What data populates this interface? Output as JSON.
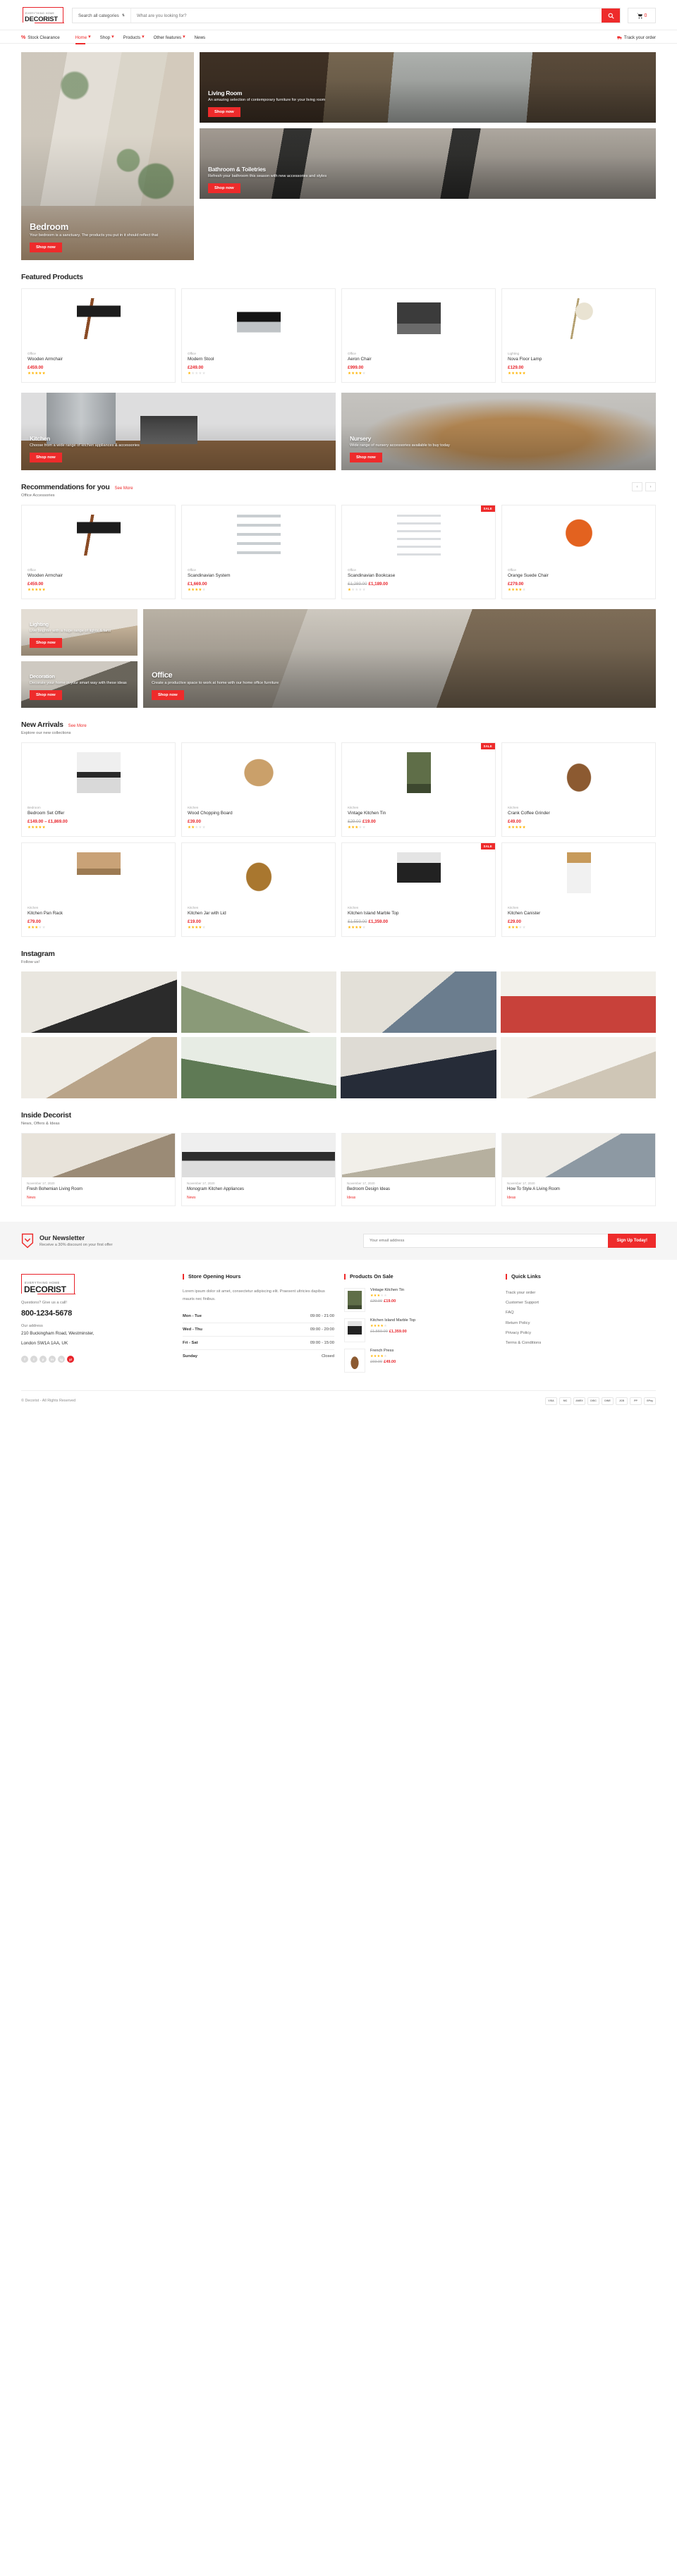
{
  "brand": {
    "tagline": "EVERYTHING HOME",
    "name": "DECORIST",
    "accent": "#ee2b2b"
  },
  "header": {
    "search_category": "Search all categories",
    "search_placeholder": "What are you looking for?",
    "search_value": "",
    "search_icon": "search-icon",
    "cart_icon": "cart-icon",
    "cart_count": "0"
  },
  "nav": {
    "stock_clearance": "Stock Clearance",
    "items": [
      {
        "label": "Home",
        "has_caret": true,
        "active": true
      },
      {
        "label": "Shop",
        "has_caret": true,
        "active": false
      },
      {
        "label": "Products",
        "has_caret": true,
        "active": false
      },
      {
        "label": "Other features",
        "has_caret": true,
        "active": false
      },
      {
        "label": "News",
        "has_caret": false,
        "active": false
      }
    ],
    "track_order": "Track your order"
  },
  "hero": {
    "bedroom": {
      "title": "Bedroom",
      "subtitle": "Your bedroom is a sanctuary. The products you put in it should reflect that",
      "cta": "Shop now"
    },
    "living_room": {
      "title": "Living Room",
      "subtitle": "An amazing selection of contemporary furniture for your living room",
      "cta": "Shop now"
    },
    "bathroom": {
      "title": "Bathroom & Toiletries",
      "subtitle": "Refresh your bathroom this season with new accessories and styles",
      "cta": "Shop now"
    }
  },
  "featured": {
    "title": "Featured Products",
    "products": [
      {
        "category": "Office",
        "name": "Wooden Armchair",
        "price": "£459.00",
        "old_price": "",
        "rating": 5,
        "sale": false,
        "art": "p-armchair"
      },
      {
        "category": "Office",
        "name": "Modern Stool",
        "price": "£249.00",
        "old_price": "",
        "rating": 1,
        "sale": false,
        "art": "p-stool"
      },
      {
        "category": "Office",
        "name": "Aeron Chair",
        "price": "£999.00",
        "old_price": "",
        "rating": 4,
        "sale": false,
        "art": "p-aeron"
      },
      {
        "category": "Lighting",
        "name": "Nova Floor Lamp",
        "price": "£129.00",
        "old_price": "",
        "rating": 5,
        "sale": false,
        "art": "p-lamp"
      }
    ]
  },
  "kitchen_banner": {
    "title": "Kitchen",
    "subtitle": "Choose from a wide range of kitchen appliances & accessories",
    "cta": "Shop now"
  },
  "nursery_banner": {
    "title": "Nursery",
    "subtitle": "Wide range of nursery accessories available to buy today",
    "cta": "Shop now"
  },
  "recommendations": {
    "title": "Recommendations for you",
    "see_more": "See More",
    "subtitle": "Office Accessories",
    "prev_icon": "chevron-left-icon",
    "next_icon": "chevron-right-icon",
    "products": [
      {
        "category": "Office",
        "name": "Wooden Armchair",
        "price": "£459.00",
        "old_price": "",
        "rating": 5,
        "sale": false,
        "art": "p-armchair"
      },
      {
        "category": "Office",
        "name": "Scandinavian System",
        "price": "£1,669.00",
        "old_price": "",
        "rating": 4,
        "sale": false,
        "art": "p-shelf"
      },
      {
        "category": "Office",
        "name": "Scandinavian Bookcase",
        "price": "£1,189.00",
        "old_price": "£1,289.00",
        "rating": 1,
        "sale": true,
        "art": "p-bookcase"
      },
      {
        "category": "Office",
        "name": "Orange Suede Chair",
        "price": "£279.00",
        "old_price": "",
        "rating": 4,
        "sale": false,
        "art": "p-orangechair"
      }
    ]
  },
  "mid_banners": {
    "lighting": {
      "title": "Lighting",
      "subtitle": "Live brighter with a huge range of lights & fans",
      "cta": "Shop now"
    },
    "decoration": {
      "title": "Decoration",
      "subtitle": "Decorate your home in your smart way with these ideas",
      "cta": "Shop now"
    },
    "office": {
      "title": "Office",
      "subtitle": "Create a productive space to work at home with our home office furniture",
      "cta": "Shop now"
    }
  },
  "new_arrivals": {
    "title": "New Arrivals",
    "see_more": "See More",
    "subtitle": "Explore our new collections",
    "products": [
      {
        "category": "Bedroom",
        "name": "Bedroom Set Offer",
        "price": "£149.00 – £1,869.00",
        "old_price": "",
        "rating": 5,
        "sale": false,
        "art": "p-bedset"
      },
      {
        "category": "Kitchen",
        "name": "Wood Chopping Board",
        "price": "£39.00",
        "old_price": "",
        "rating": 2,
        "sale": false,
        "art": "p-board"
      },
      {
        "category": "Kitchen",
        "name": "Vintage Kitchen Tin",
        "price": "£19.00",
        "old_price": "£29.00",
        "rating": 3,
        "sale": true,
        "art": "p-tin"
      },
      {
        "category": "Kitchen",
        "name": "Crank Coffee Grinder",
        "price": "£49.00",
        "old_price": "",
        "rating": 5,
        "sale": false,
        "art": "p-grinder"
      },
      {
        "category": "Kitchen",
        "name": "Kitchen Pan Rack",
        "price": "£79.00",
        "old_price": "",
        "rating": 3,
        "sale": false,
        "art": "p-panrack"
      },
      {
        "category": "Kitchen",
        "name": "Kitchen Jar with Lid",
        "price": "£19.00",
        "old_price": "",
        "rating": 4,
        "sale": false,
        "art": "p-jar"
      },
      {
        "category": "Kitchen",
        "name": "Kitchen Island Marble Top",
        "price": "£1,359.00",
        "old_price": "£1,559.00",
        "rating": 4,
        "sale": true,
        "art": "p-island"
      },
      {
        "category": "Kitchen",
        "name": "Kitchen Canister",
        "price": "£29.00",
        "old_price": "",
        "rating": 3,
        "sale": false,
        "art": "p-canister"
      }
    ]
  },
  "instagram": {
    "title": "Instagram",
    "subtitle": "Follow us!",
    "cells": [
      "ig1",
      "ig2",
      "ig3",
      "ig4",
      "ig5",
      "ig6",
      "ig7",
      "ig8"
    ]
  },
  "blog": {
    "title": "Inside Decorist",
    "subtitle": "News, Offers & Ideas",
    "posts": [
      {
        "date": "November 17, 2020",
        "title": "Fresh Bohemian Living Room",
        "tag": "News",
        "art": "bi1"
      },
      {
        "date": "November 17, 2020",
        "title": "Monogram Kitchen Appliances",
        "tag": "News",
        "art": "bi2"
      },
      {
        "date": "November 17, 2020",
        "title": "Bedroom Design Ideas",
        "tag": "Ideas",
        "art": "bi3"
      },
      {
        "date": "November 17, 2020",
        "title": "How To Style A Living Room",
        "tag": "Ideas",
        "art": "bi4"
      }
    ]
  },
  "newsletter": {
    "icon": "tag-icon",
    "title": "Our Newsletter",
    "subtitle": "Receive a 30% discount on your first offer",
    "placeholder": "Your email address",
    "value": "",
    "button": "Sign Up Today!"
  },
  "footer": {
    "call_label": "Questions? Give us a call!",
    "phone": "800-1234-5678",
    "address_label": "Our address",
    "address_line1": "210 Buckingham Road, Westminster,",
    "address_line2": "London SW1A 1AA, UK",
    "socials": [
      "f",
      "t",
      "p",
      "in",
      "ig",
      "yt"
    ],
    "hours": {
      "heading": "Store Opening Hours",
      "description": "Lorem ipsum dolor sit amet, consectetur adipiscing elit. Praesent ultricies dapibus mauris nec finibus.",
      "rows": [
        {
          "day": "Mon - Tue",
          "time": "09:00 - 21:00"
        },
        {
          "day": "Wed - Thu",
          "time": "09:00 - 20:00"
        },
        {
          "day": "Fri - Sat",
          "time": "09:00 - 15:00"
        },
        {
          "day": "Sunday",
          "time": "Closed"
        }
      ]
    },
    "on_sale": {
      "heading": "Products On Sale",
      "items": [
        {
          "name": "Vintage Kitchen Tin",
          "rating": 3,
          "old_price": "£29.00",
          "price": "£19.00",
          "art": "p-tin"
        },
        {
          "name": "Kitchen Island Marble Top",
          "rating": 4,
          "old_price": "£1,559.00",
          "price": "£1,359.00",
          "art": "p-island"
        },
        {
          "name": "French Press",
          "rating": 4,
          "old_price": "£69.00",
          "price": "£49.00",
          "art": "p-grinder"
        }
      ]
    },
    "quick_links": {
      "heading": "Quick Links",
      "items": [
        "Track your order",
        "Customer Support",
        "FAQ",
        "Return Policy",
        "Privacy Policy",
        "Terms & Conditions"
      ]
    },
    "copyright": "© Decorist - All Rights Reserved",
    "payments": [
      "VISA",
      "MC",
      "AMEX",
      "DISC",
      "DINE",
      "JCB",
      "PP",
      "GPay"
    ]
  }
}
